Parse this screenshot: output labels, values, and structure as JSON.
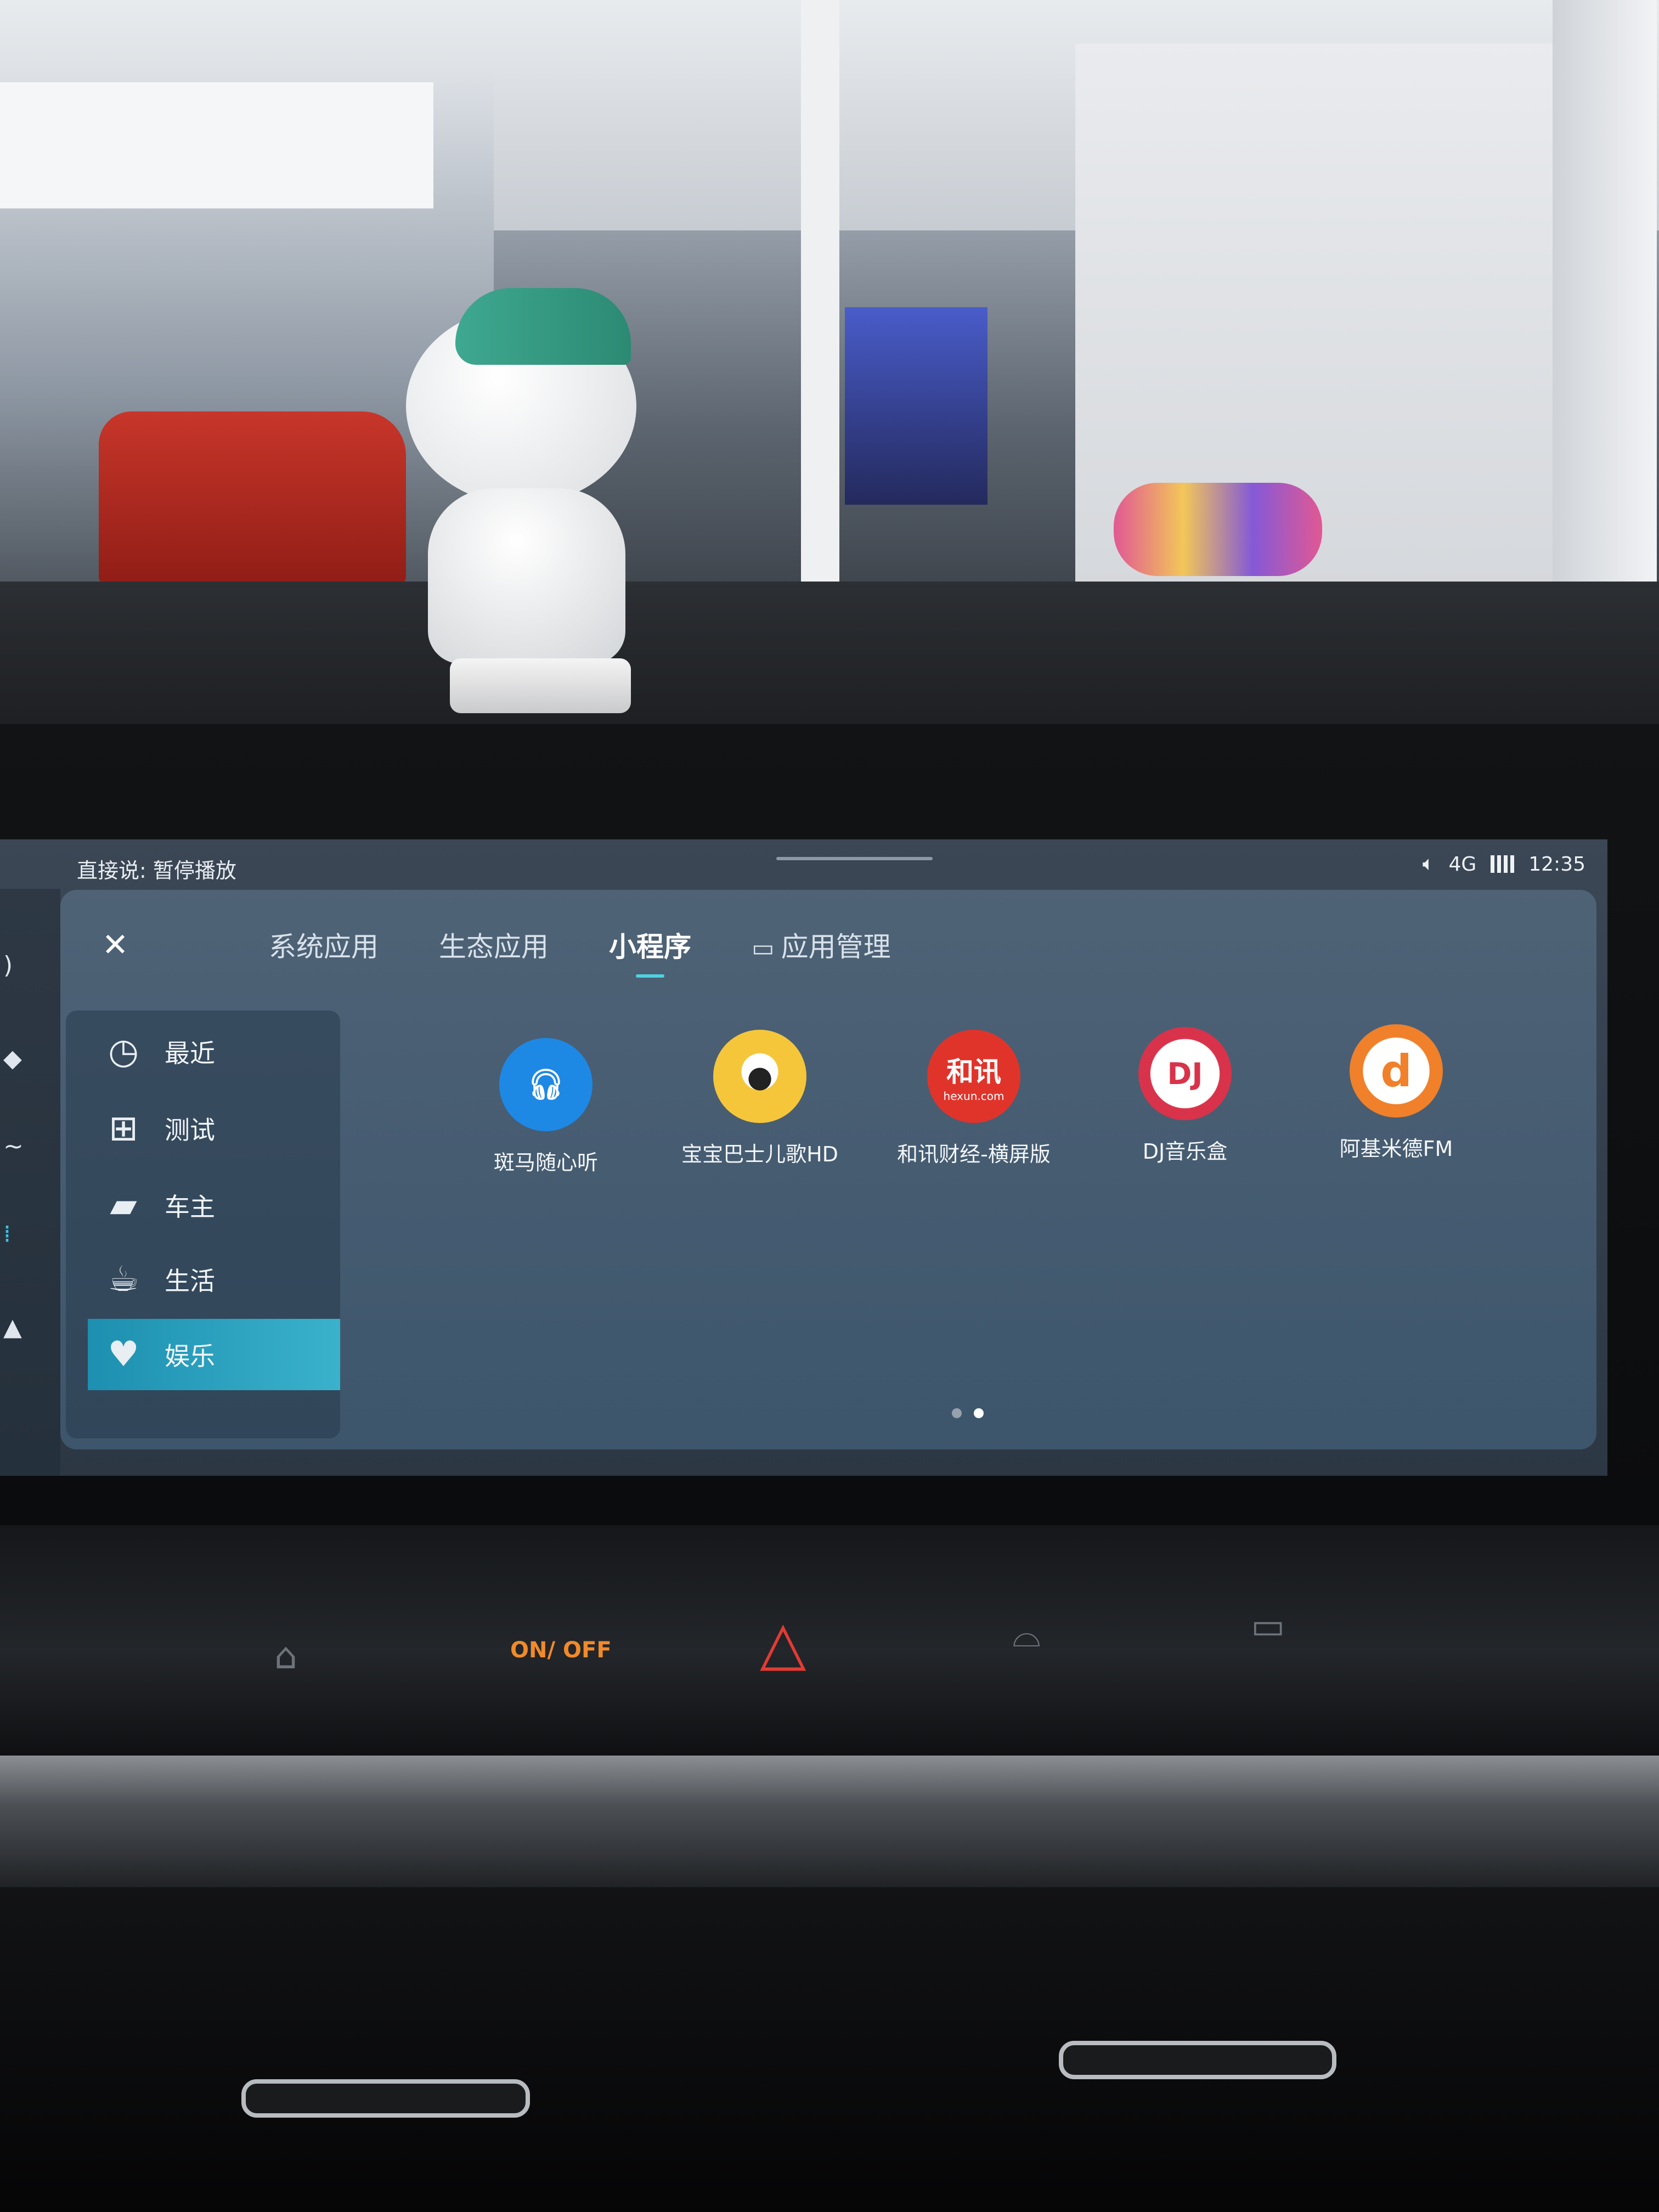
{
  "statusbar": {
    "voice_hint": "直接说: 暂停播放",
    "volume_icon": "speaker-icon",
    "network": "4G",
    "time": "12:35"
  },
  "tabs": [
    {
      "label": "系统应用",
      "active": false
    },
    {
      "label": "生态应用",
      "active": false
    },
    {
      "label": "小程序",
      "active": true
    },
    {
      "label": "应用管理",
      "active": false,
      "icon": "store-icon"
    }
  ],
  "categories": [
    {
      "label": "最近",
      "icon": "clock-icon",
      "active": false
    },
    {
      "label": "测试",
      "icon": "gamepad-icon",
      "active": false
    },
    {
      "label": "车主",
      "icon": "car-icon",
      "active": false
    },
    {
      "label": "生活",
      "icon": "cup-icon",
      "active": false
    },
    {
      "label": "娱乐",
      "icon": "heart-icon",
      "active": true
    }
  ],
  "apps": [
    {
      "label": "斑马随心听",
      "icon": "headphones-icon",
      "color": "#1e88e5"
    },
    {
      "label": "宝宝巴士儿歌HD",
      "icon": "panda-icon",
      "color": "#f5c63a"
    },
    {
      "label": "和讯财经-横屏版",
      "icon_text": "和讯",
      "icon_subtext": "hexun.com",
      "color": "#e0342b"
    },
    {
      "label": "DJ音乐盒",
      "icon_text": "DJ",
      "color": "#d8334a"
    },
    {
      "label": "阿基米德FM",
      "icon": "radio-d-icon",
      "color": "#f0802a"
    }
  ],
  "pager": {
    "pages": 2,
    "current": 2
  },
  "hardware": {
    "onoff_label": "ON/ OFF"
  }
}
